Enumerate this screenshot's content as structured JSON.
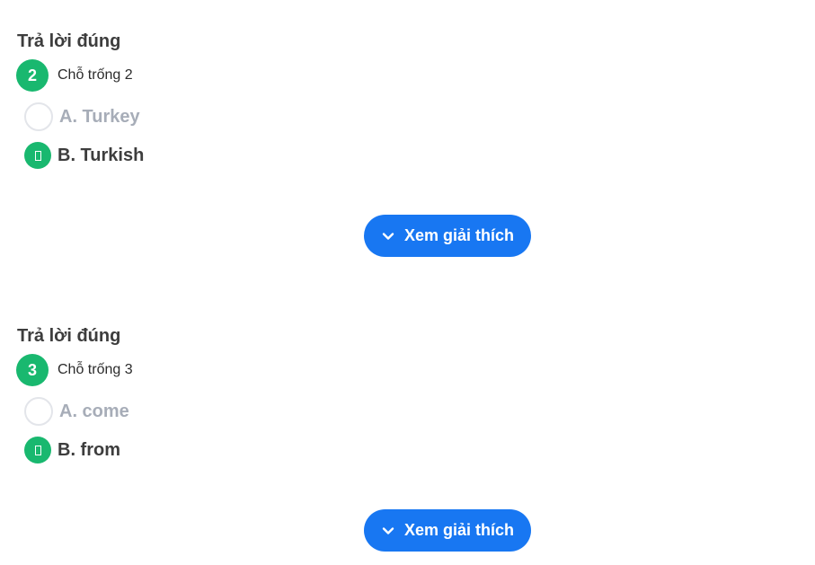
{
  "colors": {
    "correct_green": "#19b86f",
    "button_blue": "#1877f2",
    "muted_text": "#a7adb8",
    "strong_text": "#3d3d3d"
  },
  "questions": [
    {
      "result_title": "Trả lời đúng",
      "number": "2",
      "label": "Chỗ trống 2",
      "options": [
        {
          "text": "A. Turkey",
          "selected": false
        },
        {
          "text": "B. Turkish",
          "selected": true
        }
      ],
      "explain_button": {
        "label": "Xem giải thích",
        "icon": "chevron-down-icon"
      }
    },
    {
      "result_title": "Trả lời đúng",
      "number": "3",
      "label": "Chỗ trống 3",
      "options": [
        {
          "text": "A. come",
          "selected": false
        },
        {
          "text": "B. from",
          "selected": true
        }
      ],
      "explain_button": {
        "label": "Xem giải thích",
        "icon": "chevron-down-icon"
      }
    }
  ]
}
